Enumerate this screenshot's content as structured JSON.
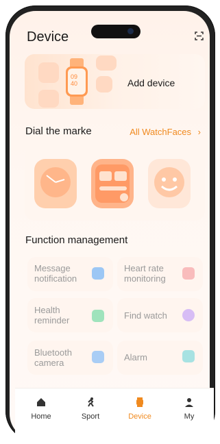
{
  "header": {
    "title": "Device"
  },
  "add_device": {
    "label": "Add device"
  },
  "dial_market": {
    "heading": "Dial the marke",
    "link_label": "All WatchFaces",
    "chevron": "›"
  },
  "functions": {
    "heading": "Function management",
    "items": [
      {
        "line1": "Message",
        "line2": "notification",
        "icon": "message-icon",
        "color": "#7fb4f0"
      },
      {
        "line1": "Heart rate",
        "line2": "monitoring",
        "icon": "heart-rate-icon",
        "color": "#f6a2a2"
      },
      {
        "line1": "Health",
        "line2": "reminder",
        "icon": "health-icon",
        "color": "#7ed6a6"
      },
      {
        "line1": "Find watch",
        "line2": "",
        "icon": "watch-icon",
        "color": "#c6a2f0"
      },
      {
        "line1": "Bluetooth",
        "line2": "camera",
        "icon": "camera-icon",
        "color": "#7fb4f0"
      },
      {
        "line1": "Alarm",
        "line2": "",
        "icon": "alarm-icon",
        "color": "#7fd6d6"
      }
    ]
  },
  "tabs": [
    {
      "label": "Home",
      "icon": "home-icon"
    },
    {
      "label": "Sport",
      "icon": "run-icon"
    },
    {
      "label": "Device",
      "icon": "watch-icon"
    },
    {
      "label": "My",
      "icon": "person-icon"
    }
  ],
  "colors": {
    "accent": "#f08a1f",
    "active_tab": "#f08a1f"
  }
}
